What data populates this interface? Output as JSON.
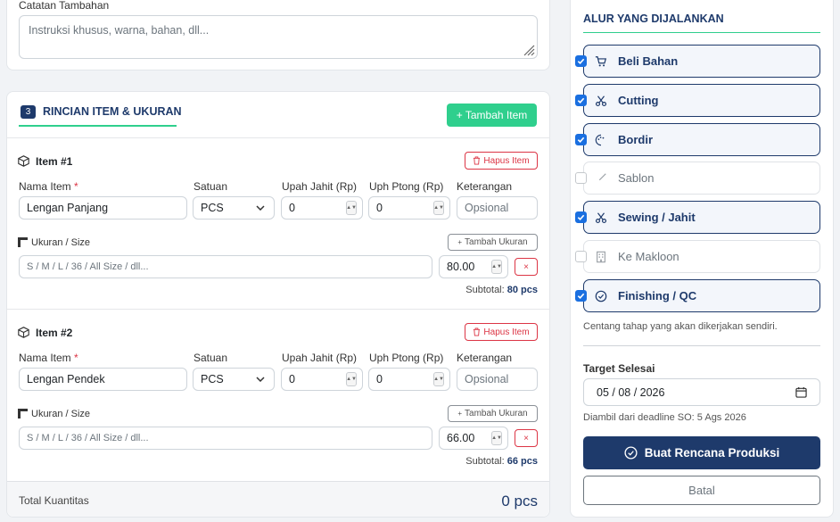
{
  "notes": {
    "label": "Catatan Tambahan",
    "placeholder": "Instruksi khusus, warna, bahan, dll..."
  },
  "items_section": {
    "step": "3",
    "title": "RINCIAN ITEM & UKURAN",
    "add_item_label": "+ Tambah Item",
    "field_labels": {
      "name": "Nama Item",
      "required": "*",
      "unit": "Satuan",
      "sew_wage": "Upah Jahit (Rp)",
      "cut_wage": "Uph Ptong (Rp)",
      "note": "Keterangan",
      "size": "Ukuran / Size"
    },
    "delete_label": "Hapus Item",
    "add_size_label": "Tambah Ukuran",
    "size_placeholder": "S / M / L / 36 / All Size / dll...",
    "note_placeholder": "Opsional",
    "subtotal_label": "Subtotal:",
    "remove_size_label": "×",
    "items": [
      {
        "title": "Item #1",
        "name": "Lengan Panjang",
        "unit": "PCS",
        "sew_wage": "0",
        "cut_wage": "0",
        "qty": "80.00",
        "subtotal": "80 pcs"
      },
      {
        "title": "Item #2",
        "name": "Lengan Pendek",
        "unit": "PCS",
        "sew_wage": "0",
        "cut_wage": "0",
        "qty": "66.00",
        "subtotal": "66 pcs"
      }
    ],
    "total_label": "Total Kuantitas",
    "total_value": "0 pcs"
  },
  "flow": {
    "title": "ALUR YANG DIJALANKAN",
    "steps": [
      {
        "label": "Beli Bahan",
        "checked": true,
        "icon": "cart-icon"
      },
      {
        "label": "Cutting",
        "checked": true,
        "icon": "scissors-icon"
      },
      {
        "label": "Bordir",
        "checked": true,
        "icon": "palette-icon"
      },
      {
        "label": "Sablon",
        "checked": false,
        "icon": "brush-icon"
      },
      {
        "label": "Sewing / Jahit",
        "checked": true,
        "icon": "scissors-icon"
      },
      {
        "label": "Ke Makloon",
        "checked": false,
        "icon": "building-icon"
      },
      {
        "label": "Finishing / QC",
        "checked": true,
        "icon": "check-circle-icon"
      }
    ],
    "hint": "Centang tahap yang akan dikerjakan sendiri.",
    "target_label": "Target Selesai",
    "target_date": "05 / 08 / 2026",
    "deadline_note": "Diambil dari deadline SO: 5 Ags 2026",
    "submit_label": "Buat Rencana Produksi",
    "cancel_label": "Batal"
  },
  "colors": {
    "primary": "#1e3a6b",
    "accent_green": "#2fcf8d",
    "danger": "#dc3545",
    "checkbox": "#1a6fe0"
  }
}
